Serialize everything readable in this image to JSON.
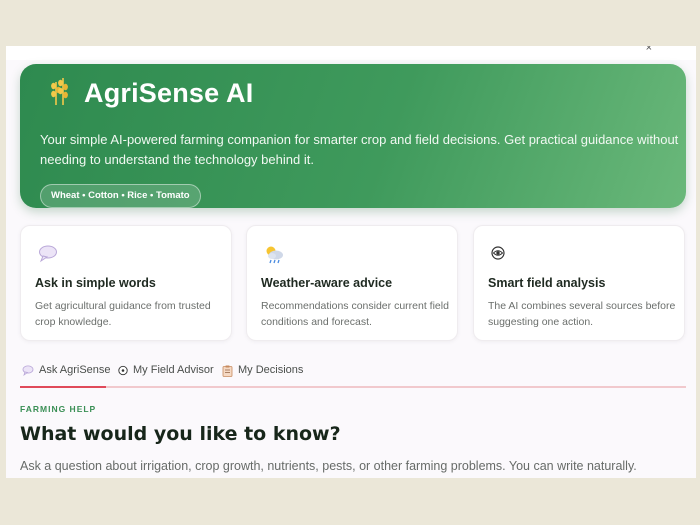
{
  "window": {
    "close_glyph": "×"
  },
  "hero": {
    "title": "AgriSense AI",
    "logo_icon": "wheat-icon",
    "description": "Your simple AI-powered farming companion for smarter crop and field decisions. Get practical guidance without needing to understand the technology behind it.",
    "crops_pill": "Wheat • Cotton • Rice • Tomato",
    "colors": {
      "gradient_start": "#2e8a4f",
      "gradient_end": "#6ab87a"
    }
  },
  "features": [
    {
      "icon": "speech-bubble-icon",
      "title": "Ask in simple words",
      "description": "Get agricultural guidance from trusted crop knowledge."
    },
    {
      "icon": "weather-icon",
      "title": "Weather-aware advice",
      "description": "Recommendations consider current field conditions and forecast."
    },
    {
      "icon": "eye-icon",
      "title": "Smart field analysis",
      "description": "The AI combines several sources before suggesting one action."
    }
  ],
  "tabs": [
    {
      "icon": "speech-bubble-icon",
      "label": "Ask AgriSense",
      "active": true
    },
    {
      "icon": "eye-icon",
      "label": "My Field Advisor",
      "active": false
    },
    {
      "icon": "clipboard-icon",
      "label": "My Decisions",
      "active": false
    }
  ],
  "section": {
    "eyebrow": "FARMING HELP",
    "heading": "What would you like to know?",
    "description": "Ask a question about irrigation, crop growth, nutrients, pests, or other farming problems. You can write naturally."
  },
  "accent_colors": {
    "brand_green": "#3a8f55",
    "active_tab": "#e04a5a"
  }
}
